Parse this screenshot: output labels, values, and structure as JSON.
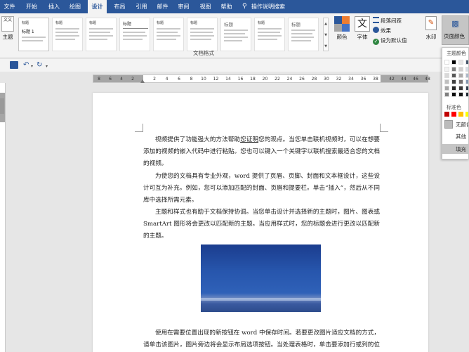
{
  "tabs": [
    {
      "id": "file",
      "label": "文件"
    },
    {
      "id": "home",
      "label": "开始"
    },
    {
      "id": "insert",
      "label": "插入"
    },
    {
      "id": "draw",
      "label": "绘图"
    },
    {
      "id": "design",
      "label": "设计"
    },
    {
      "id": "layout",
      "label": "布局"
    },
    {
      "id": "refs",
      "label": "引用"
    },
    {
      "id": "mail",
      "label": "邮件"
    },
    {
      "id": "review",
      "label": "审阅"
    },
    {
      "id": "view",
      "label": "视图"
    },
    {
      "id": "help",
      "label": "帮助"
    },
    {
      "id": "tellme",
      "label": "操作说明搜索"
    }
  ],
  "ribbon": {
    "themes_label": "主题",
    "themes_icon_text": "文文",
    "doc_format_label": "文档格式",
    "gallery": [
      {
        "title": "标题 1",
        "sub": "标题"
      },
      {
        "title": "标题",
        "sub": ""
      },
      {
        "title": "标题",
        "sub": ""
      },
      {
        "title": "标题",
        "sub": "标题 1"
      },
      {
        "title": "标题",
        "sub": ""
      },
      {
        "title": "标题",
        "sub": ""
      },
      {
        "title": "标题",
        "sub": ""
      },
      {
        "title": "标题",
        "sub": ""
      },
      {
        "title": "标题",
        "sub": ""
      }
    ],
    "colors_label": "颜色",
    "fonts_label": "字体",
    "fonts_icon_text": "文",
    "paragraph_spacing_label": "段落间距",
    "effects_label": "效果",
    "set_default_label": "设为默认值",
    "watermark_label": "水印",
    "page_color_label": "页面颜色"
  },
  "ruler": {
    "left_numbers": [
      "8",
      "6",
      "4",
      "2"
    ],
    "main_numbers": [
      "2",
      "4",
      "6",
      "8",
      "10",
      "12",
      "14",
      "16",
      "18",
      "20",
      "22",
      "24",
      "26",
      "28",
      "30",
      "32",
      "34",
      "36",
      "38"
    ],
    "right_numbers": [
      "42",
      "44",
      "46",
      "48"
    ]
  },
  "document": {
    "paragraphs": [
      {
        "pre": "视频提供了功能强大的方法帮助",
        "underlined": "您证明",
        "post": "您的观点。当您单击联机视频时，可以在想要添加的视频的嵌入代码中进行粘贴。您也可以键入一个关键字以联机搜索最适合您的文档的视频。"
      },
      {
        "pre": "为使您的文档具有专业外观，word 提供了页眉、页脚、封面和文本框设计，这些设计可互为补充。例如，您可以添加匹配的封面、页眉和提要栏。单击“插入”，然后从不同库中选择所需元素。",
        "underlined": "",
        "post": ""
      },
      {
        "pre": "主题和样式也有助于文档保持协调。当您单击设计并选择新的主题时，图片、图表或 SmartArt 图形将会更改以匹配新的主题。当应用样式时，您的标题会进行更改以匹配新的主题。",
        "underlined": "",
        "post": ""
      },
      {
        "pre": "使用在需要位置出现的新按钮在 word 中保存时间。若要更改图片适应文档的方式，请单击该图片，图片旁边将会显示布局选项按钮。当处理表格时，单击要添加行或列的位置，然后单击加号。",
        "underlined": "",
        "post": ""
      }
    ]
  },
  "page_color_menu": {
    "theme_colors_label": "主题颜色",
    "standard_colors_label": "标准色",
    "no_color_label": "无颜色",
    "other_colors_label": "其他",
    "fill_effects_label": "填充",
    "standard_colors": [
      "#c00000",
      "#ff0000",
      "#ffc000",
      "#ffff00"
    ]
  }
}
